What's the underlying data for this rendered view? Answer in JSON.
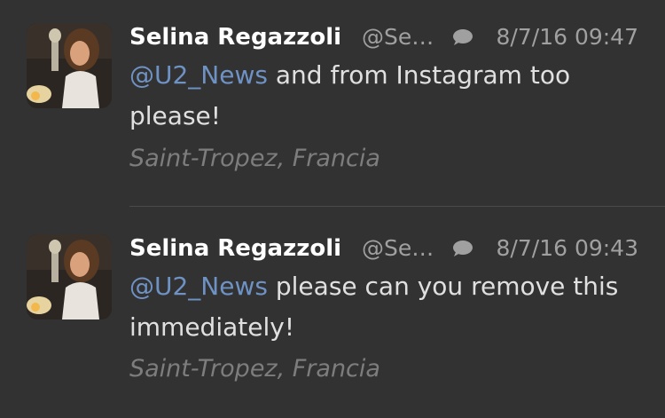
{
  "tweets": [
    {
      "author_name": "Selina Regazzoli",
      "handle": "@Se…",
      "timestamp": "8/7/16 09:47",
      "mention": "@U2_News",
      "text": "and from Instagram too please!",
      "location": "Saint-Tropez, Francia"
    },
    {
      "author_name": "Selina Regazzoli",
      "handle": "@Se…",
      "timestamp": "8/7/16 09:43",
      "mention": "@U2_News",
      "text": "please can you remove this immediately!",
      "location": "Saint-Tropez, Francia"
    }
  ],
  "icons": {
    "reply": "speech-bubble-icon"
  },
  "colors": {
    "background": "#323232",
    "mention": "#6f92c4",
    "name": "#ffffff",
    "meta": "#a0a0a0",
    "location": "#7d7d7d"
  }
}
